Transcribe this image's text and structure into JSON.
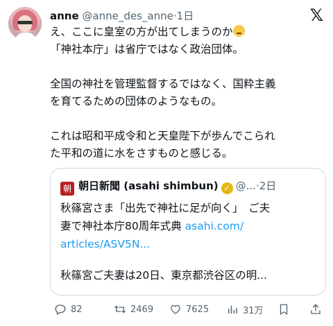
{
  "author": {
    "name": "anne",
    "handle": "@anne_des_anne",
    "separator": "·",
    "time": "1日"
  },
  "brand_logo": "𝕏",
  "tweet_text": "え、ここに皇室の方が出てしまうのか\n「神社本庁」は省庁ではなく政治団体。\n\n全国の神社を管理監督するではなく、国粋主義\nを育てるための団体のようなもの。\n\nこれは昭和平成令和と天皇陛下が歩んでこられ\nた平和の道に水をさすものと感じる。",
  "emoji": "sad-face-emoji",
  "quoted": {
    "logo_text": "朝",
    "source_name": "朝日新聞 (asahi shimbun)",
    "verified_icon": "✓",
    "handle": "@...",
    "separator": "·",
    "time": "2日",
    "body_text": "秋篠宮さま「出先で神社に足が向く」　ご夫\n妻で神社本庁80周年式典 ",
    "link_text": "asahi.com/\narticles/ASV5N...",
    "snippet": "秋篠宮ご夫妻は20日、東京都渋谷区の明..."
  },
  "actions": {
    "replies": "82",
    "reposts": "2469",
    "likes": "7625",
    "views": "31万"
  },
  "colors": {
    "accent": "#1d9bf0",
    "muted": "#536471",
    "border": "#cfd9de",
    "asahi_red": "#b52025",
    "verified_gold": "#e2b719"
  }
}
